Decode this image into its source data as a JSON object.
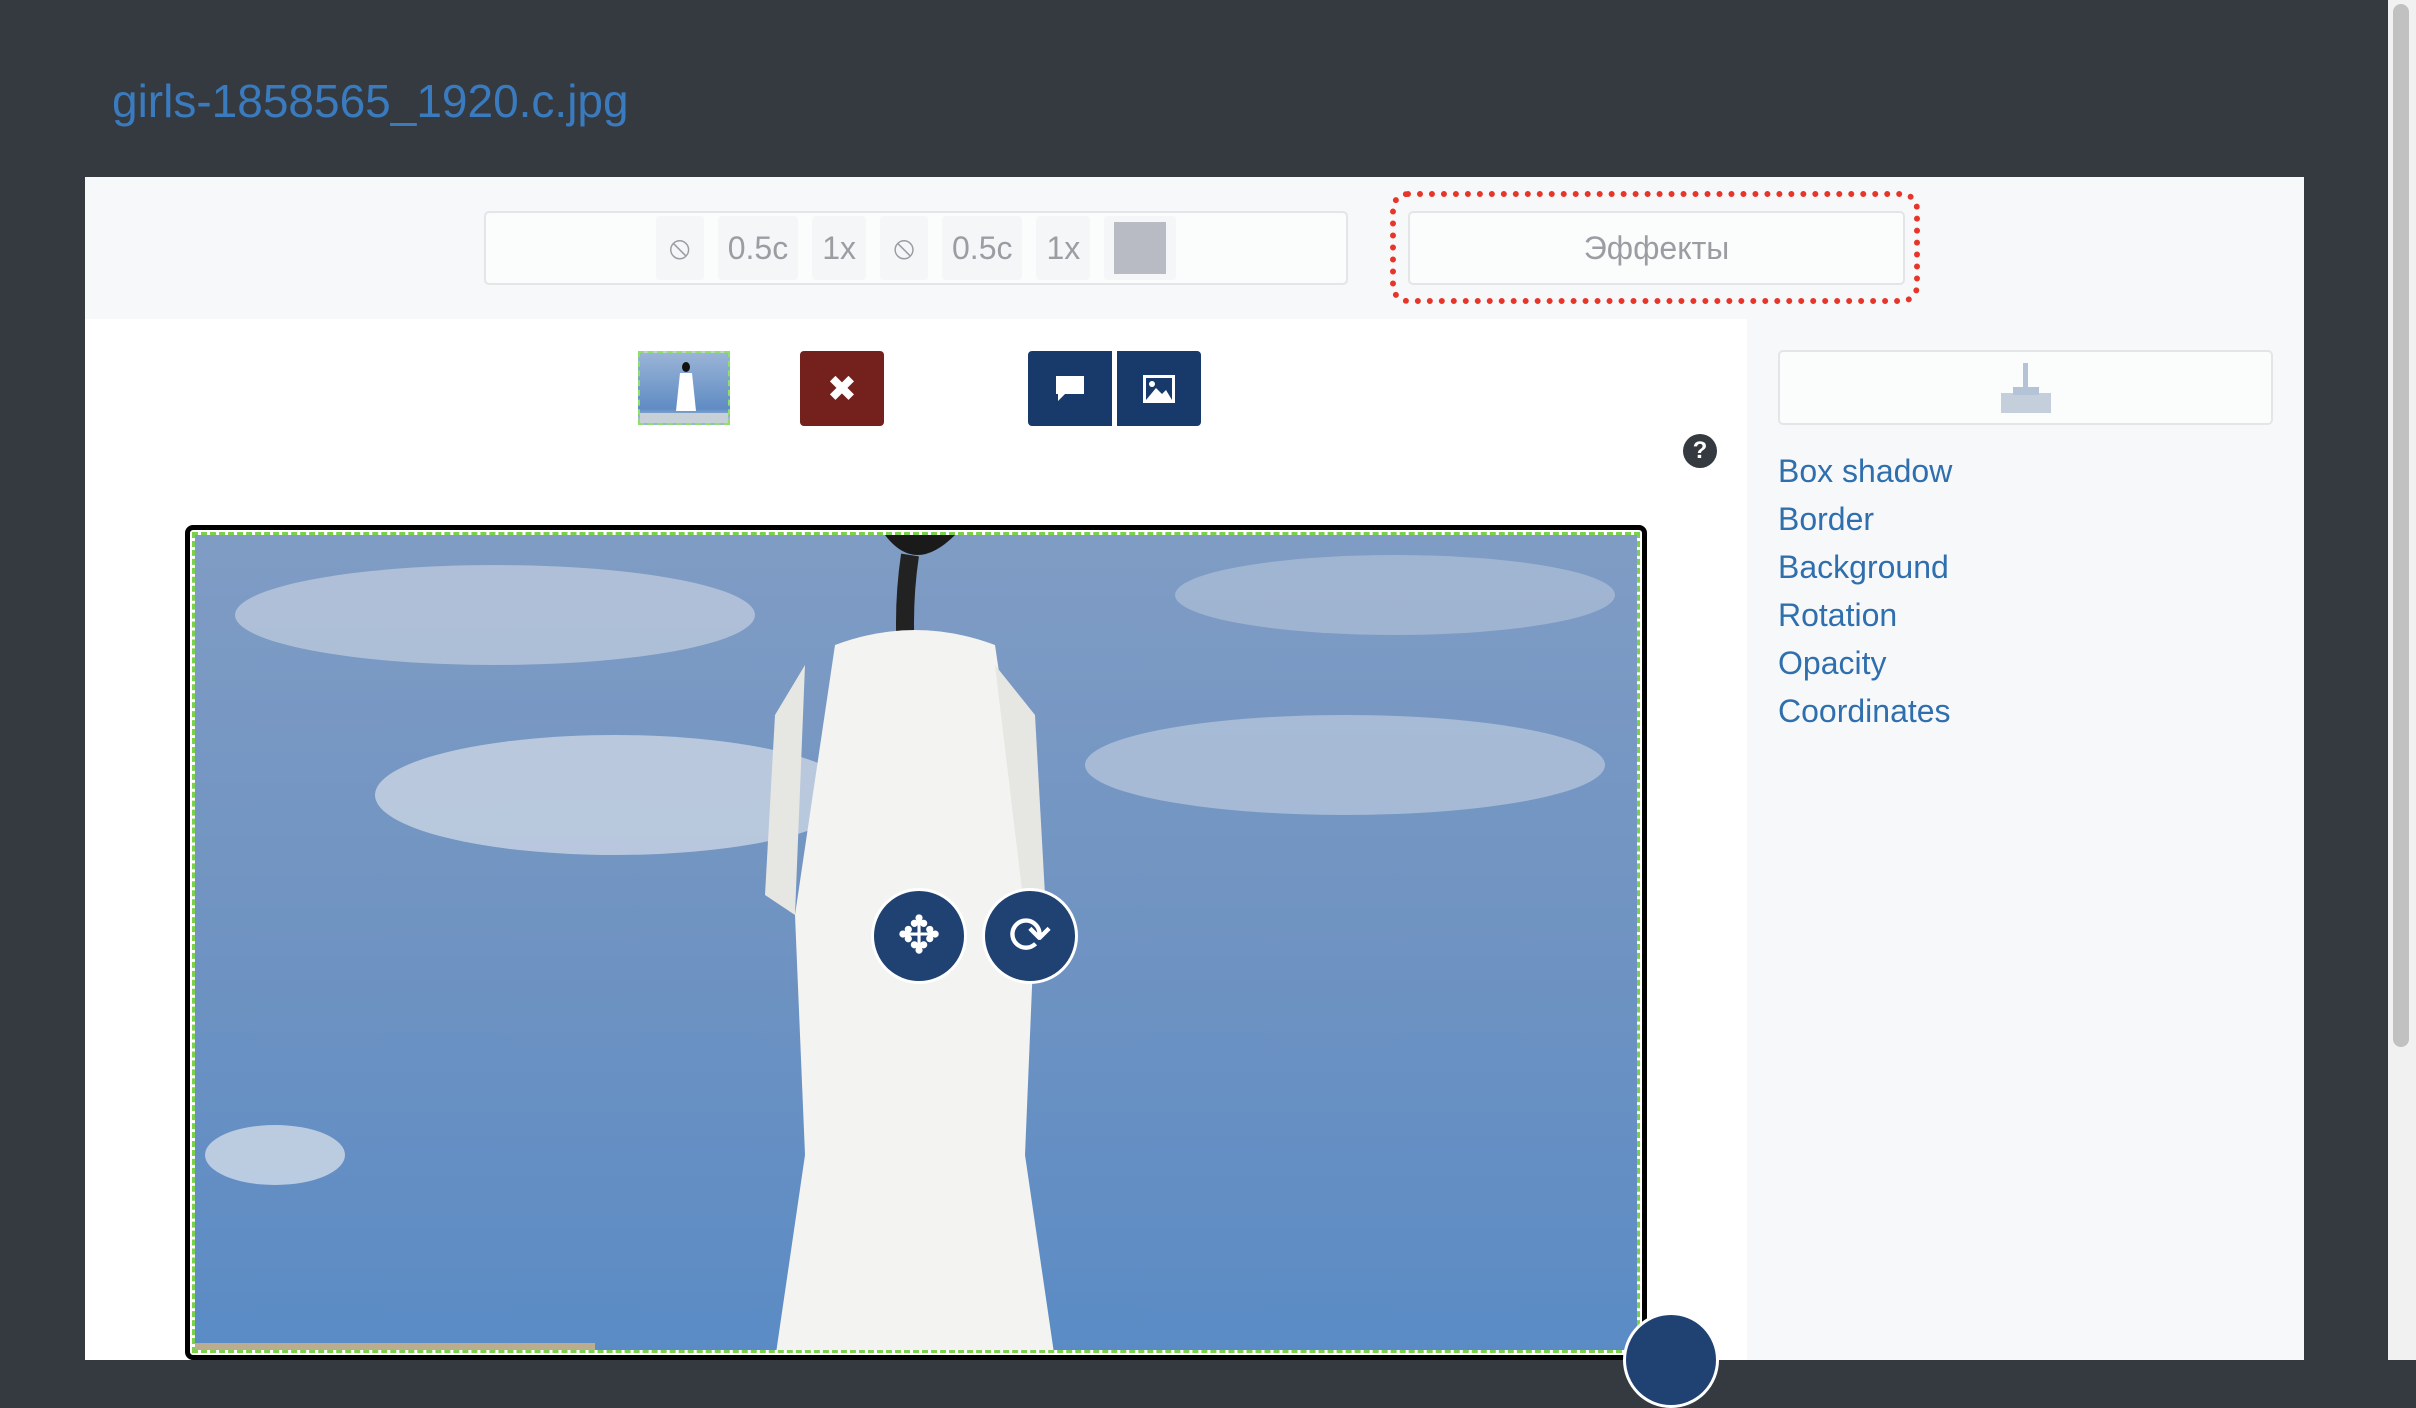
{
  "header": {
    "title": "girls-1858565_1920.c.jpg"
  },
  "toolbar": {
    "buttons": [
      {
        "icon": "ban-icon",
        "label": "⦸"
      },
      {
        "label": "0.5c"
      },
      {
        "label": "1x"
      },
      {
        "icon": "ban-icon",
        "label": "⦸"
      },
      {
        "label": "0.5c"
      },
      {
        "label": "1x"
      }
    ],
    "swatch_color": "#b8bbc4",
    "effects_label": "Эффекты"
  },
  "actions": {
    "delete_icon": "✖",
    "comment_icon": "comment-icon",
    "image_icon": "image-icon",
    "help": "?"
  },
  "sidebar": {
    "links": [
      "Box shadow",
      "Border",
      "Background",
      "Rotation",
      "Opacity",
      "Coordinates"
    ]
  },
  "colors": {
    "accent": "#2f6fae",
    "delete": "#74201d",
    "primary": "#173a6b",
    "highlight": "#e8352a"
  }
}
